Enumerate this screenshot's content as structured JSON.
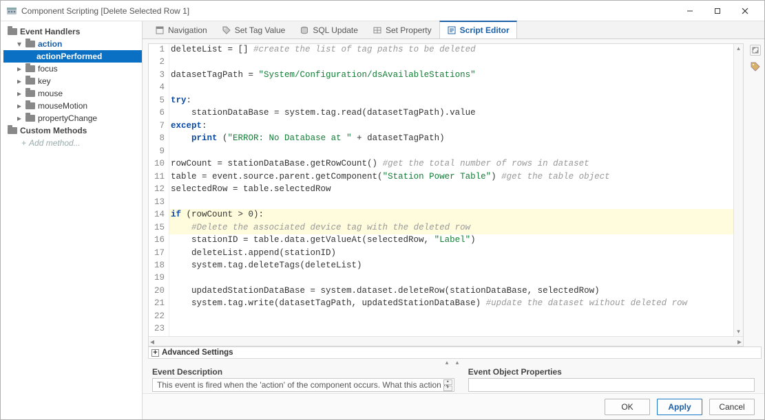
{
  "window": {
    "title": "Component Scripting [Delete Selected Row 1]"
  },
  "sidebar": {
    "header1": "Event Handlers",
    "items": [
      {
        "label": "action",
        "expandable": true,
        "expanded": true,
        "bold": true,
        "indent": 0
      },
      {
        "label": "actionPerformed",
        "expandable": false,
        "expanded": false,
        "selected": true,
        "indent": 1
      },
      {
        "label": "focus",
        "expandable": true,
        "expanded": false,
        "indent": 0
      },
      {
        "label": "key",
        "expandable": true,
        "expanded": false,
        "indent": 0
      },
      {
        "label": "mouse",
        "expandable": true,
        "expanded": false,
        "indent": 0
      },
      {
        "label": "mouseMotion",
        "expandable": true,
        "expanded": false,
        "indent": 0
      },
      {
        "label": "propertyChange",
        "expandable": true,
        "expanded": false,
        "indent": 0
      }
    ],
    "header2": "Custom Methods",
    "add_method": "Add method..."
  },
  "tabs": [
    {
      "label": "Navigation",
      "icon": "nav-icon"
    },
    {
      "label": "Set Tag Value",
      "icon": "tag-icon"
    },
    {
      "label": "SQL Update",
      "icon": "db-icon"
    },
    {
      "label": "Set Property",
      "icon": "prop-icon"
    },
    {
      "label": "Script Editor",
      "icon": "script-icon",
      "active": true
    }
  ],
  "code_lines": [
    {
      "n": 1,
      "t": [
        [
          "",
          "deleteList = [] "
        ],
        [
          "cmt",
          "#create the list of tag paths to be deleted"
        ]
      ]
    },
    {
      "n": 2,
      "t": [
        [
          "",
          ""
        ]
      ]
    },
    {
      "n": 3,
      "t": [
        [
          "",
          "datasetTagPath = "
        ],
        [
          "str",
          "\"System/Configuration/dsAvailableStations\""
        ]
      ]
    },
    {
      "n": 4,
      "t": [
        [
          "",
          ""
        ]
      ]
    },
    {
      "n": 5,
      "t": [
        [
          "kw",
          "try"
        ],
        [
          "",
          ":"
        ]
      ]
    },
    {
      "n": 6,
      "t": [
        [
          "",
          "    stationDataBase = system.tag.read(datasetTagPath).value"
        ]
      ]
    },
    {
      "n": 7,
      "t": [
        [
          "kw",
          "except"
        ],
        [
          "",
          ":"
        ]
      ]
    },
    {
      "n": 8,
      "t": [
        [
          "",
          "    "
        ],
        [
          "kw",
          "print"
        ],
        [
          "",
          " ("
        ],
        [
          "str",
          "\"ERROR: No Database at \""
        ],
        [
          "",
          " + datasetTagPath)"
        ]
      ]
    },
    {
      "n": 9,
      "t": [
        [
          "",
          ""
        ]
      ]
    },
    {
      "n": 10,
      "t": [
        [
          "",
          "rowCount = stationDataBase.getRowCount() "
        ],
        [
          "cmt",
          "#get the total number of rows in dataset"
        ]
      ]
    },
    {
      "n": 11,
      "t": [
        [
          "",
          "table = event.source.parent.getComponent("
        ],
        [
          "str",
          "\"Station Power Table\""
        ],
        [
          "",
          ") "
        ],
        [
          "cmt",
          "#get the table object"
        ]
      ]
    },
    {
      "n": 12,
      "t": [
        [
          "",
          "selectedRow = table.selectedRow"
        ]
      ]
    },
    {
      "n": 13,
      "t": [
        [
          "",
          ""
        ]
      ]
    },
    {
      "n": 14,
      "t": [
        [
          "kw",
          "if"
        ],
        [
          "",
          " (rowCount > 0):"
        ]
      ],
      "hl": true
    },
    {
      "n": 15,
      "t": [
        [
          "",
          "    "
        ],
        [
          "cmt",
          "#Delete the associated device tag with the deleted row"
        ]
      ],
      "hl": true
    },
    {
      "n": 16,
      "t": [
        [
          "",
          "    stationID = table.data.getValueAt(selectedRow, "
        ],
        [
          "str",
          "\"Label\""
        ],
        [
          "",
          ")"
        ]
      ]
    },
    {
      "n": 17,
      "t": [
        [
          "",
          "    deleteList.append(stationID)"
        ]
      ]
    },
    {
      "n": 18,
      "t": [
        [
          "",
          "    system.tag.deleteTags(deleteList)"
        ]
      ]
    },
    {
      "n": 19,
      "t": [
        [
          "",
          ""
        ]
      ]
    },
    {
      "n": 20,
      "t": [
        [
          "",
          "    updatedStationDataBase = system.dataset.deleteRow(stationDataBase, selectedRow)"
        ]
      ]
    },
    {
      "n": 21,
      "t": [
        [
          "",
          "    system.tag.write(datasetTagPath, updatedStationDataBase) "
        ],
        [
          "cmt",
          "#update the dataset without deleted row"
        ]
      ]
    },
    {
      "n": 22,
      "t": [
        [
          "",
          ""
        ]
      ]
    },
    {
      "n": 23,
      "t": [
        [
          "",
          ""
        ]
      ]
    }
  ],
  "advanced_label": "Advanced Settings",
  "descrow": {
    "event_desc_label": "Event Description",
    "event_desc_text": "This event is fired when the 'action' of the component occurs. What this action is",
    "event_obj_label": "Event Object Properties",
    "event_obj_text": ""
  },
  "buttons": {
    "ok": "OK",
    "apply": "Apply",
    "cancel": "Cancel"
  }
}
